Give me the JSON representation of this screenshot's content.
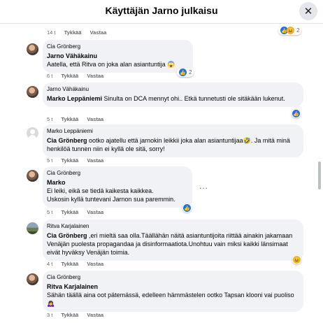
{
  "dialog": {
    "title": "Käyttäjän Jarno julkaisu",
    "close_icon": "close-icon"
  },
  "colors": {
    "bubble": "#f0f2f5",
    "link_blue": "#1b74e4",
    "meta_gray": "#65676b"
  },
  "top_fragment": {
    "time": "14 t",
    "like": "Tykkää",
    "reply": "Vastaa",
    "reaction_count": "2"
  },
  "comments": [
    {
      "author": "Cia Grönberg",
      "mention": "Jarno Vähäkainu",
      "text": "Aatella, että Ritva on joka alan asiantuntija",
      "emoji": "😱",
      "time": "6 t",
      "like": "Tykkää",
      "reply": "Vastaa",
      "reaction_count": "2"
    },
    {
      "author": "Jarno Vähäkainu",
      "mention": "Marko Leppäniemi",
      "text": "Sinulta on DCA mennyt ohi.. Etkä tunnetusti ole sitäkään lukenut.",
      "time": "5 t",
      "like": "Tykkää",
      "reply": "Vastaa"
    },
    {
      "author": "Marko Leppäniemi",
      "mention": "Cia Grönberg",
      "text": "ootko ajatellu että jarnokin leikkii joka alan asiantuntijaa",
      "emoji": "🤣",
      "text2": ". Ja mitä minä henkilöä tunnen niin ei kyllä ole sitä, sorry!",
      "time": "5 t",
      "like": "Tykkää",
      "reply": "Vastaa"
    },
    {
      "author": "Cia Grönberg",
      "mention": "Marko",
      "text": "Ei leiki, eikä se tiedä kaikesta kaikkea.",
      "text2": "Uskosin kyllä tuntevani Jarnon sua paremmin.",
      "time": "5 t",
      "like": "Tykkää",
      "reply": "Vastaa",
      "more": "..."
    },
    {
      "author": "Ritva Karjalainen",
      "mention": "Cia Grönberg",
      "text": ",eri mieltä saa olla.Täällähän näitä asiantuntijoita riittää ainakin jakamaan Venäjän puolesta propagandaa ja disinformaatiota.Unohtuu vain miksi kaikki länsimaat eivät hyväksy Venäjän toimia.",
      "time": "4 t",
      "like": "Tykkää",
      "reply": "Vastaa"
    },
    {
      "author": "Cia Grönberg",
      "mention": "Ritva Karjalainen",
      "text": "Sähän täällä aina oot pätemässä, edelleen hämmästelen ootko Tapsan klooni vai puoliso",
      "emoji": "🙇‍♀️",
      "time": "3 t",
      "like": "Tykkää",
      "reply": "Vastaa"
    }
  ]
}
